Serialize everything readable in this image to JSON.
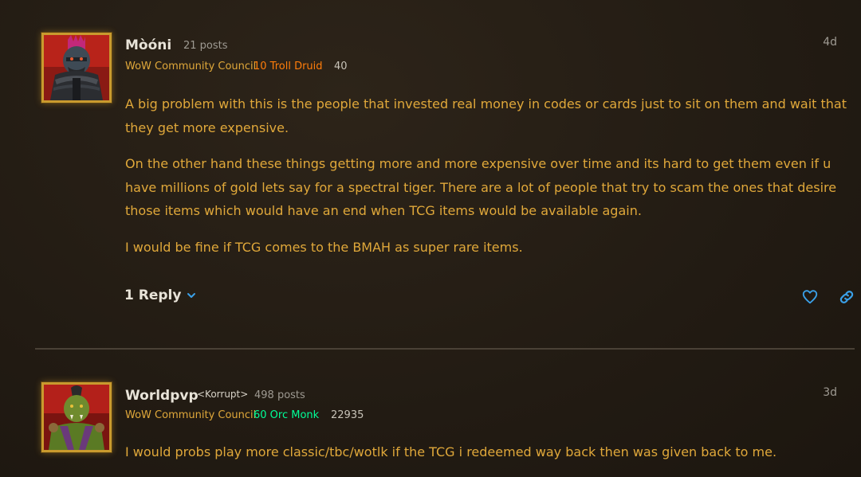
{
  "posts": [
    {
      "username": "Mòóni",
      "posts_count": "21 posts",
      "council": "WoW Community Council",
      "class_label": "10 Troll Druid",
      "class_color": "#ff7d0a",
      "achievement": "40",
      "date": "4d",
      "avatar_icon": "troll-druid-avatar",
      "paragraphs": [
        "A big problem with this is the people that invested real money in codes or cards just to sit on them and wait that they get more expensive.",
        "On the other hand these things getting more and more expensive over time and its hard to get them even if u have millions of gold lets say for a spectral tiger. There are a lot of people that try to scam the ones that desire those items which would have an end when TCG items would be available again.",
        "I would be fine if TCG comes to the BMAH as super rare items."
      ],
      "reply_label": "1 Reply",
      "like_icon": "heart-icon",
      "link_icon": "link-icon"
    },
    {
      "username": "Worldpvp",
      "guild": "<Korrupt>",
      "posts_count": "498 posts",
      "council": "WoW Community Council",
      "class_label": "60 Orc Monk",
      "class_color": "#00ff98",
      "achievement": "22935",
      "date": "3d",
      "avatar_icon": "orc-monk-avatar",
      "paragraphs": [
        "I would probs play more classic/tbc/wotlk if the TCG i redeemed way back then was given back to me."
      ]
    }
  ],
  "colors": {
    "accent": "#e0a83a",
    "link_blue": "#3aa0e8",
    "background": "#231c14"
  }
}
